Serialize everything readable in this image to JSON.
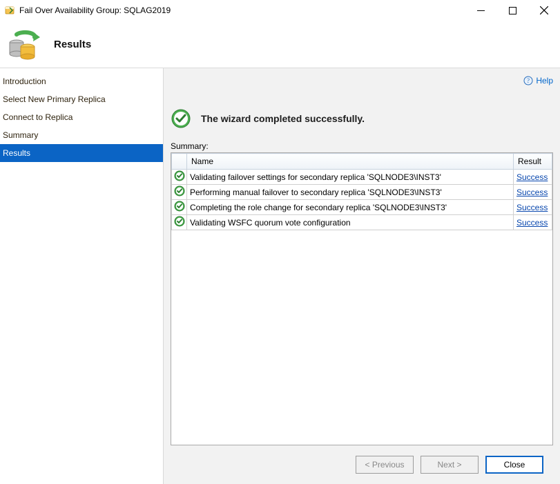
{
  "window": {
    "title": "Fail Over Availability Group: SQLAG2019"
  },
  "header": {
    "page_title": "Results"
  },
  "sidebar": {
    "items": [
      {
        "label": "Introduction",
        "selected": false
      },
      {
        "label": "Select New Primary Replica",
        "selected": false
      },
      {
        "label": "Connect to Replica",
        "selected": false
      },
      {
        "label": "Summary",
        "selected": false
      },
      {
        "label": "Results",
        "selected": true
      }
    ]
  },
  "content": {
    "help_label": "Help",
    "status_message": "The wizard completed successfully.",
    "summary_label": "Summary:",
    "columns": {
      "name": "Name",
      "result": "Result"
    },
    "rows": [
      {
        "name": "Validating failover settings for secondary replica 'SQLNODE3\\INST3'",
        "result": "Success"
      },
      {
        "name": "Performing manual failover to secondary replica 'SQLNODE3\\INST3'",
        "result": "Success"
      },
      {
        "name": "Completing the role change for secondary replica 'SQLNODE3\\INST3'",
        "result": "Success"
      },
      {
        "name": "Validating WSFC quorum vote configuration",
        "result": "Success"
      }
    ]
  },
  "buttons": {
    "previous": "< Previous",
    "next": "Next >",
    "close": "Close"
  }
}
